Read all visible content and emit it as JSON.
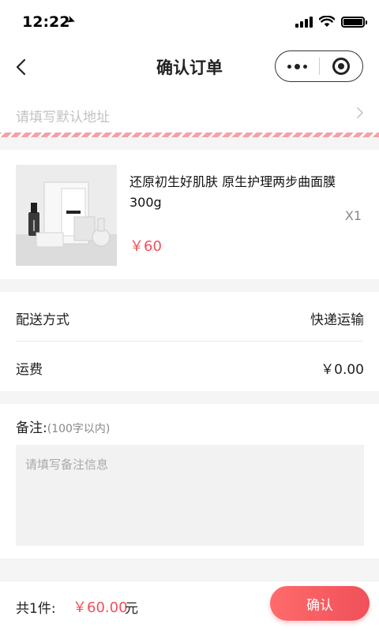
{
  "status_bar": {
    "time": "12:22"
  },
  "nav": {
    "title": "确认订单"
  },
  "address": {
    "placeholder": "请填写默认地址"
  },
  "product": {
    "name": "还原初生好肌肤  原生护理两步曲面膜300g",
    "price": "￥60",
    "quantity": "X1"
  },
  "delivery": {
    "method_label": "配送方式",
    "method_value": "快递运输",
    "fee_label": "运费",
    "fee_value": "￥0.00"
  },
  "remark": {
    "label": "备注:",
    "hint": "(100字以内)",
    "placeholder": "请填写备注信息"
  },
  "footer": {
    "total_label": "共1件:",
    "total_amount": "￥60.00",
    "total_unit": "元",
    "confirm_label": "确认"
  },
  "colors": {
    "accent": "#f0505a",
    "stripe": "#f5a0a8"
  },
  "icons": [
    "location-arrow-icon",
    "signal-icon",
    "wifi-icon",
    "battery-icon",
    "back-chevron-icon",
    "more-dots-icon",
    "close-target-icon",
    "chevron-right-icon"
  ]
}
